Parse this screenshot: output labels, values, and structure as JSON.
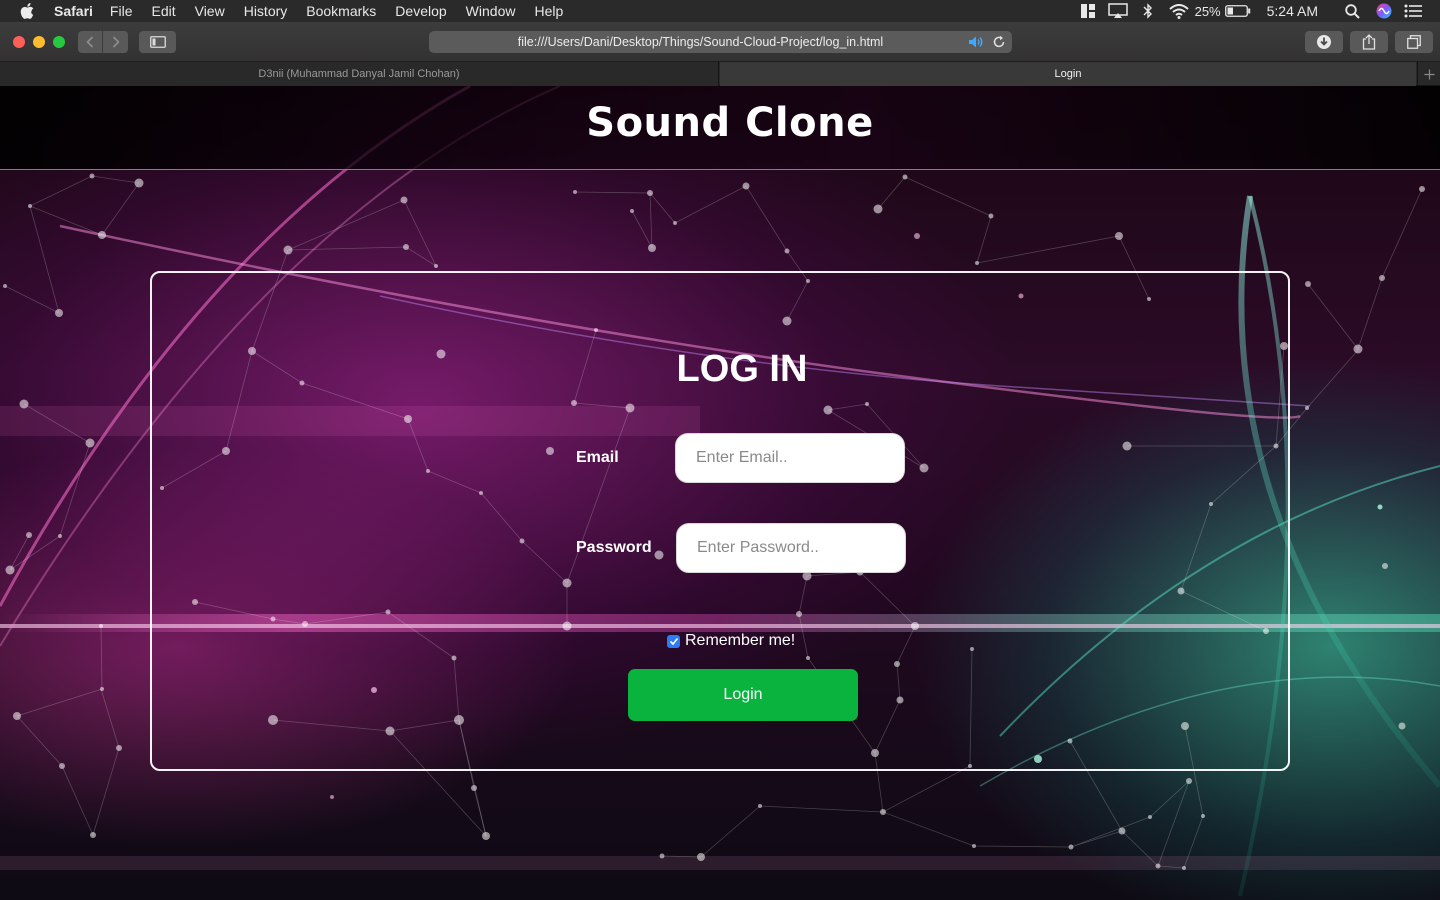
{
  "menubar": {
    "app": "Safari",
    "items": [
      "File",
      "Edit",
      "View",
      "History",
      "Bookmarks",
      "Develop",
      "Window",
      "Help"
    ],
    "battery": "25%",
    "time": "5:24 AM"
  },
  "toolbar": {
    "url": "file:///Users/Dani/Desktop/Things/Sound-Cloud-Project/log_in.html"
  },
  "tabs": [
    {
      "label": "D3nii (Muhammad Danyal Jamil Chohan)",
      "active": false
    },
    {
      "label": "Login",
      "active": true
    }
  ],
  "site": {
    "brand": "Sound Clone"
  },
  "login": {
    "title": "LOG IN",
    "email_label": "Email",
    "email_placeholder": "Enter Email..",
    "password_label": "Password",
    "password_placeholder": "Enter Password..",
    "remember_label": "Remember me!",
    "remember_checked": true,
    "submit_label": "Login"
  },
  "colors": {
    "login_button": "#0ab33e",
    "checkbox": "#2c7cf6"
  }
}
